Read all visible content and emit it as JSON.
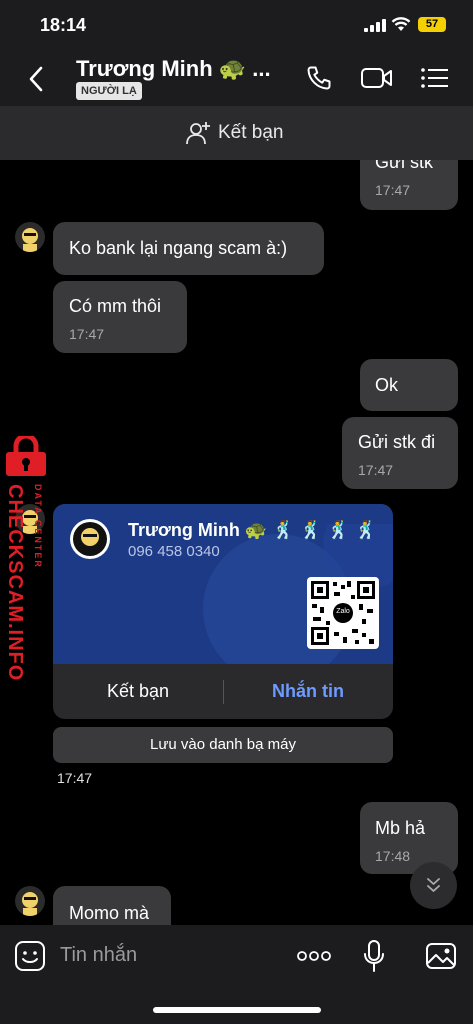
{
  "status_bar": {
    "time": "18:14",
    "battery": "57"
  },
  "header": {
    "contact_name": "Trương Minh 🐢 ...",
    "badge": "NGƯỜI LẠ"
  },
  "add_friend_bar": {
    "label": "Kết bạn"
  },
  "messages": [
    {
      "text": "Gửi stk",
      "time": "17:47"
    },
    {
      "text": "Ko bank lại ngang scam à:)"
    },
    {
      "text": "Có mm thôi",
      "time": "17:47"
    },
    {
      "text": "Ok"
    },
    {
      "text": "Gửi stk đi",
      "time": "17:47"
    },
    {
      "text": "Mb hả",
      "time": "17:48"
    },
    {
      "text": "Momo mà"
    }
  ],
  "contact_card": {
    "name": "Trương Minh 🐢 🕺 🕺 🕺 🕺 ...",
    "phone": "096 458 0340",
    "qr_logo": "Zalo",
    "add_friend": "Kết bạn",
    "message": "Nhắn tin",
    "save_contact": "Lưu vào danh bạ máy",
    "time": "17:47"
  },
  "input_bar": {
    "placeholder": "Tin nhắn"
  },
  "watermark": {
    "brand": "CHECKSCAM.INFO",
    "sub": "DATA CENTER"
  },
  "colors": {
    "card_blue": "#1c3a86",
    "link_blue": "#6d9bff",
    "watermark_red": "#e01e26"
  }
}
